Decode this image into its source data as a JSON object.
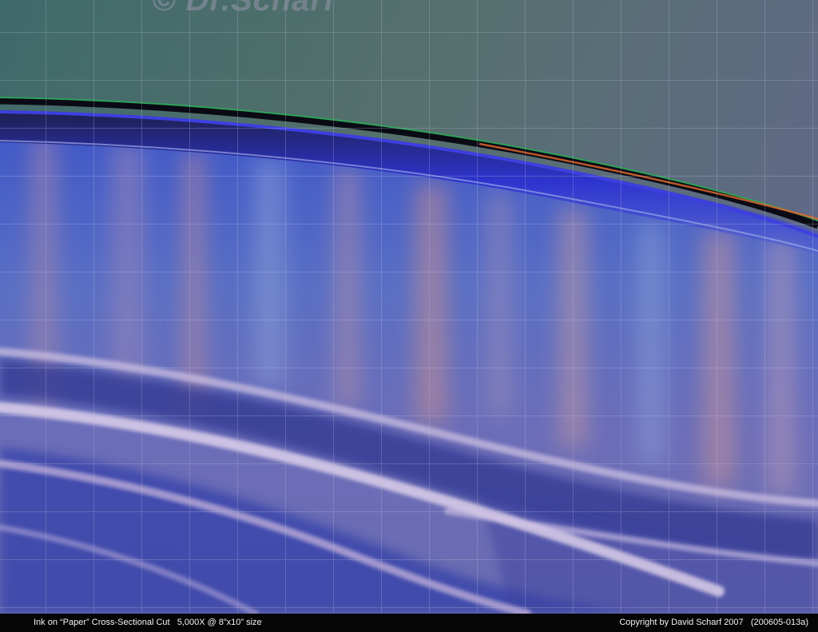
{
  "image": {
    "subject": "Ink on paper cross-section micrograph",
    "watermark_text": "© Dr.Scharf",
    "colors": {
      "upper_region": "#4f6f6e",
      "ink_layer_dark": "#0a0a14",
      "ink_blue": "#3d3fe0",
      "ink_green": "#2fa05a",
      "ink_orange": "#d9662f",
      "paper_fibers": "#5a6fc0",
      "fiber_highlight": "#c9bde0",
      "grid_line": "#b8bdd8",
      "caption_bar": "#050505"
    }
  },
  "caption": {
    "left": "Ink on “Paper” Cross-Sectional Cut   5,000X @ 8”x10” size",
    "right": "Copyright by David Scharf 2007   (200605-013a)"
  }
}
